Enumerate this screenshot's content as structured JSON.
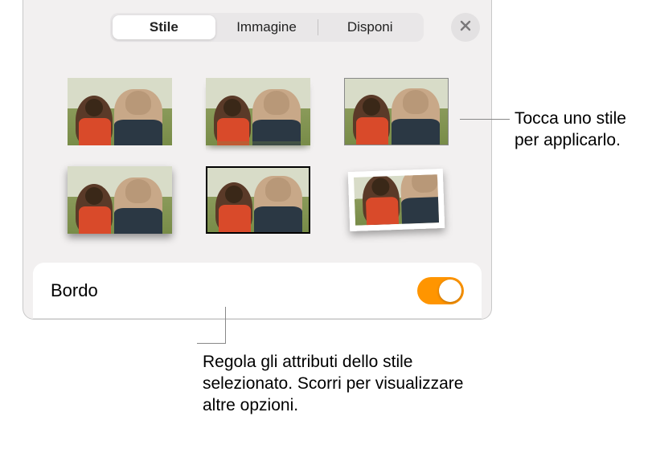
{
  "tabs": {
    "style": "Stile",
    "image": "Immagine",
    "arrange": "Disponi"
  },
  "styles": [
    {
      "name": "style-none"
    },
    {
      "name": "style-reflection"
    },
    {
      "name": "style-thin-border"
    },
    {
      "name": "style-shadow"
    },
    {
      "name": "style-black-border"
    },
    {
      "name": "style-polaroid"
    }
  ],
  "options": {
    "border_label": "Bordo",
    "border_on": true
  },
  "callouts": {
    "tap_style": "Tocca uno stile per applicarlo.",
    "adjust_attrs": "Regola gli attributi dello stile selezionato. Scorri per visualizzare altre opzioni."
  },
  "colors": {
    "accent": "#ff9500"
  }
}
